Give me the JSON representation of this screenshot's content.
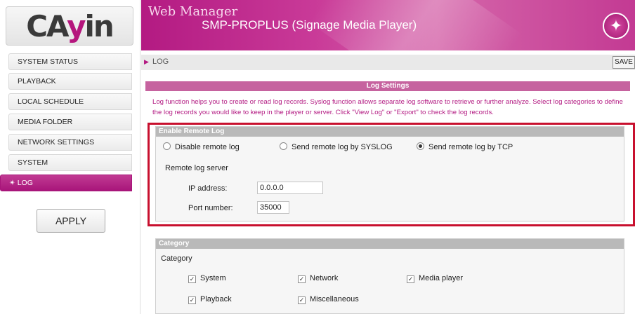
{
  "logo": {
    "text_a": "CA",
    "text_y": "y",
    "text_b": "in"
  },
  "header": {
    "title": "Web Manager",
    "subtitle": "SMP-PROPLUS (Signage Media Player)",
    "icon": "magic-wand-icon"
  },
  "sidebar": {
    "items": [
      {
        "label": "SYSTEM STATUS"
      },
      {
        "label": "PLAYBACK"
      },
      {
        "label": "LOCAL SCHEDULE"
      },
      {
        "label": "MEDIA FOLDER"
      },
      {
        "label": "NETWORK SETTINGS"
      },
      {
        "label": "SYSTEM"
      },
      {
        "label": "LOG",
        "active": true
      }
    ],
    "active_prefix": "✴ ",
    "apply_label": "APPLY"
  },
  "breadcrumb": {
    "arrow": "▶",
    "label": "LOG"
  },
  "toolbar": {
    "save_label": "SAVE"
  },
  "log_settings": {
    "title": "Log Settings",
    "description": "Log function helps you to create or read log records. Syslog function allows separate log software to retrieve or further analyze. Select log categories to define the log records you would like to keep in the player or server. Click \"View Log\" or \"Export\" to check the log records."
  },
  "remote_log": {
    "header": "Enable Remote Log",
    "options": [
      {
        "label": "Disable remote log",
        "selected": false
      },
      {
        "label": "Send remote log by SYSLOG",
        "selected": false
      },
      {
        "label": "Send remote log by TCP",
        "selected": true
      }
    ],
    "server_label": "Remote log server",
    "ip_label": "IP address:",
    "ip_value": "0.0.0.0",
    "port_label": "Port number:",
    "port_value": "35000"
  },
  "category": {
    "header": "Category",
    "label": "Category",
    "items": [
      {
        "label": "System",
        "checked": true
      },
      {
        "label": "Network",
        "checked": true
      },
      {
        "label": "Media player",
        "checked": true
      },
      {
        "label": "Playback",
        "checked": true
      },
      {
        "label": "Miscellaneous",
        "checked": true
      }
    ]
  },
  "colors": {
    "brand": "#b31a82",
    "highlight": "#c8102e"
  }
}
